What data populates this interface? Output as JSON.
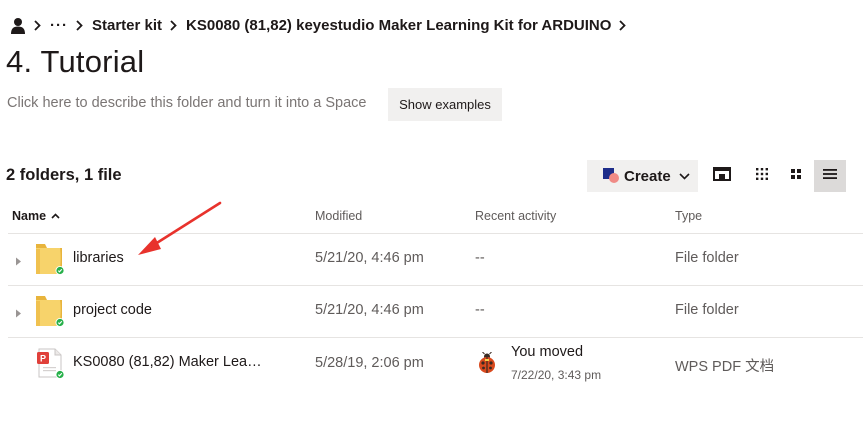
{
  "breadcrumb": {
    "items": [
      "Starter kit",
      "KS0080 (81,82) keyestudio Maker Learning Kit for ARDUINO"
    ],
    "overflow": "···"
  },
  "title": "4. Tutorial",
  "description_prompt": "Click here to describe this folder and turn it into a Space",
  "show_examples_label": "Show examples",
  "item_count": "2 folders, 1 file",
  "create_label": "Create",
  "columns": {
    "name": "Name",
    "modified": "Modified",
    "recent_activity": "Recent activity",
    "type": "Type"
  },
  "rows": [
    {
      "name": "libraries",
      "modified": "5/21/20, 4:46 pm",
      "activity": "--",
      "type": "File folder",
      "icon": "folder-icon",
      "synced": true
    },
    {
      "name": "project code",
      "modified": "5/21/20, 4:46 pm",
      "activity": "--",
      "type": "File folder",
      "icon": "folder-icon",
      "synced": true
    },
    {
      "name": "KS0080 (81,82) Maker Lea…",
      "modified": "5/28/19, 2:06 pm",
      "activity_title": "You moved",
      "activity_date": "7/22/20, 3:43 pm",
      "type": "WPS PDF 文档",
      "icon": "pdf-file-icon",
      "synced": true
    }
  ],
  "colors": {
    "accent_annotation": "#e8322c",
    "folder_yellow": "#f4c75a",
    "sync_green": "#27b04a",
    "button_bg": "#f1f0ef"
  }
}
